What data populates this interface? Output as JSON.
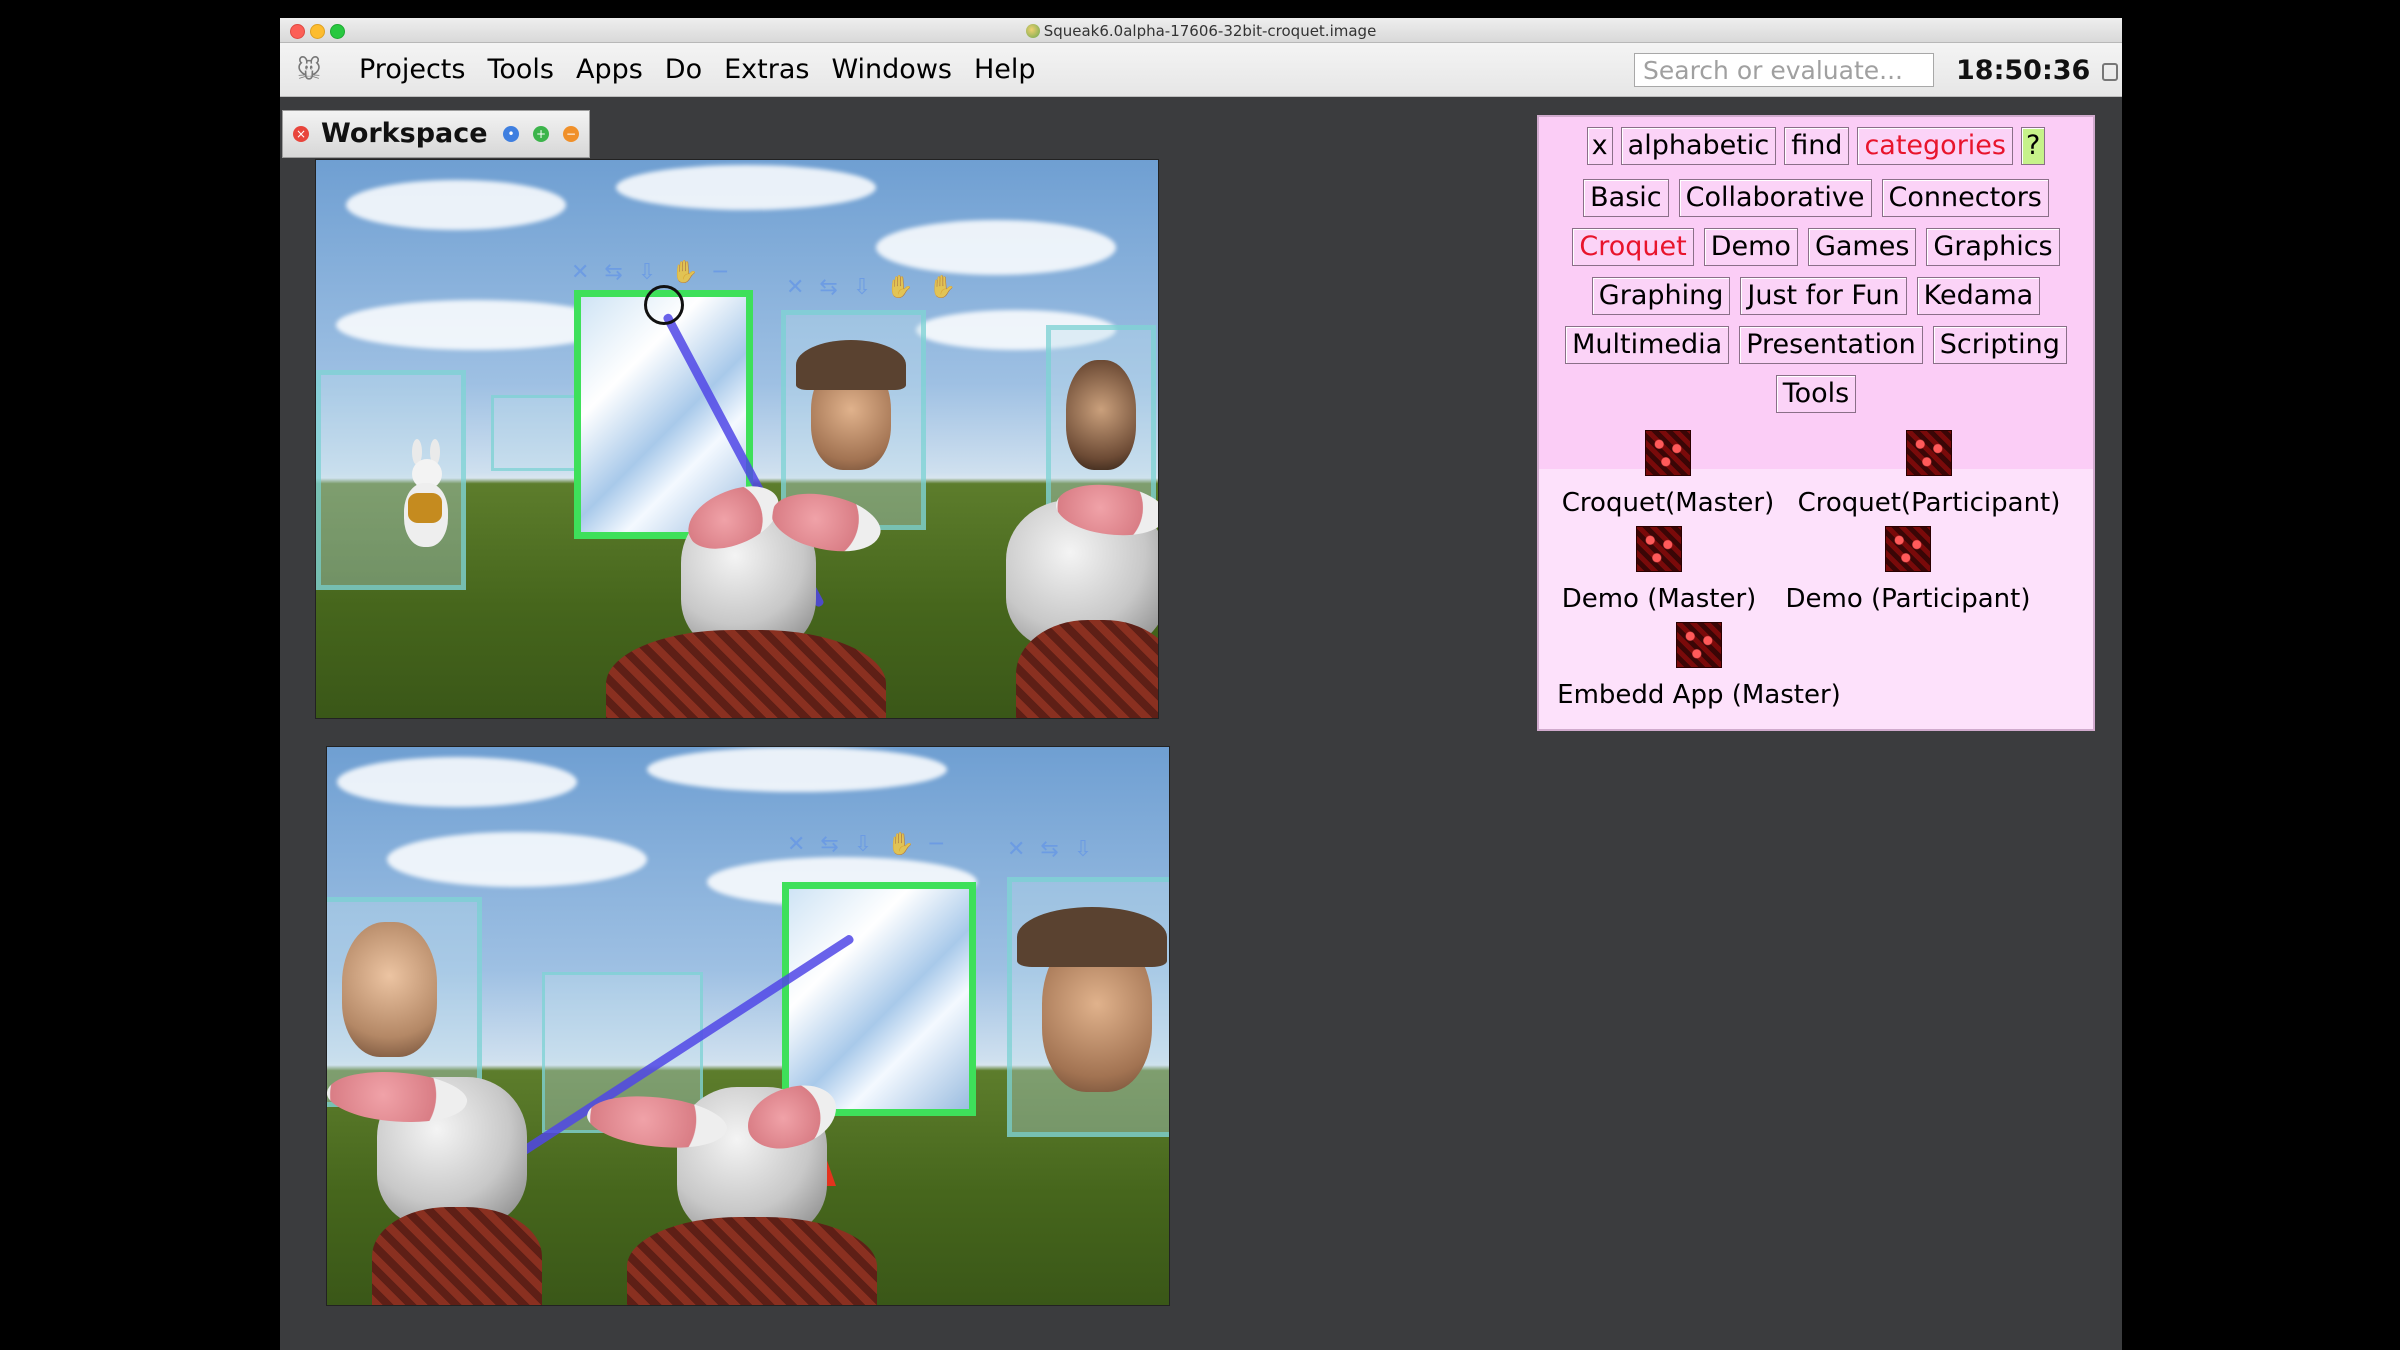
{
  "window": {
    "title": "Squeak6.0alpha-17606-32bit-croquet.image"
  },
  "menubar": {
    "items": [
      "Projects",
      "Tools",
      "Apps",
      "Do",
      "Extras",
      "Windows",
      "Help"
    ],
    "search_placeholder": "Search or evaluate...",
    "clock": "18:50:36"
  },
  "workspace": {
    "title": "Workspace"
  },
  "catalog": {
    "toolbar": {
      "close": "x",
      "alphabetic": "alphabetic",
      "find": "find",
      "categories": "categories",
      "help": "?"
    },
    "categories": [
      [
        "Basic",
        "Collaborative",
        "Connectors"
      ],
      [
        "Croquet",
        "Demo",
        "Games",
        "Graphics"
      ],
      [
        "Graphing",
        "Just for Fun",
        "Kedama"
      ],
      [
        "Multimedia",
        "Presentation",
        "Scripting"
      ],
      [
        "Tools"
      ]
    ],
    "selected_category": "Croquet",
    "parts": [
      "Croquet(Master)",
      "Croquet(Participant)",
      "Demo (Master)",
      "Demo (Participant)",
      "Embedd App (Master)"
    ]
  },
  "colors": {
    "accent_selected": "#e8142c",
    "catalog_bg": "#fde1fb",
    "desktop_bg": "#3b3c3e"
  }
}
